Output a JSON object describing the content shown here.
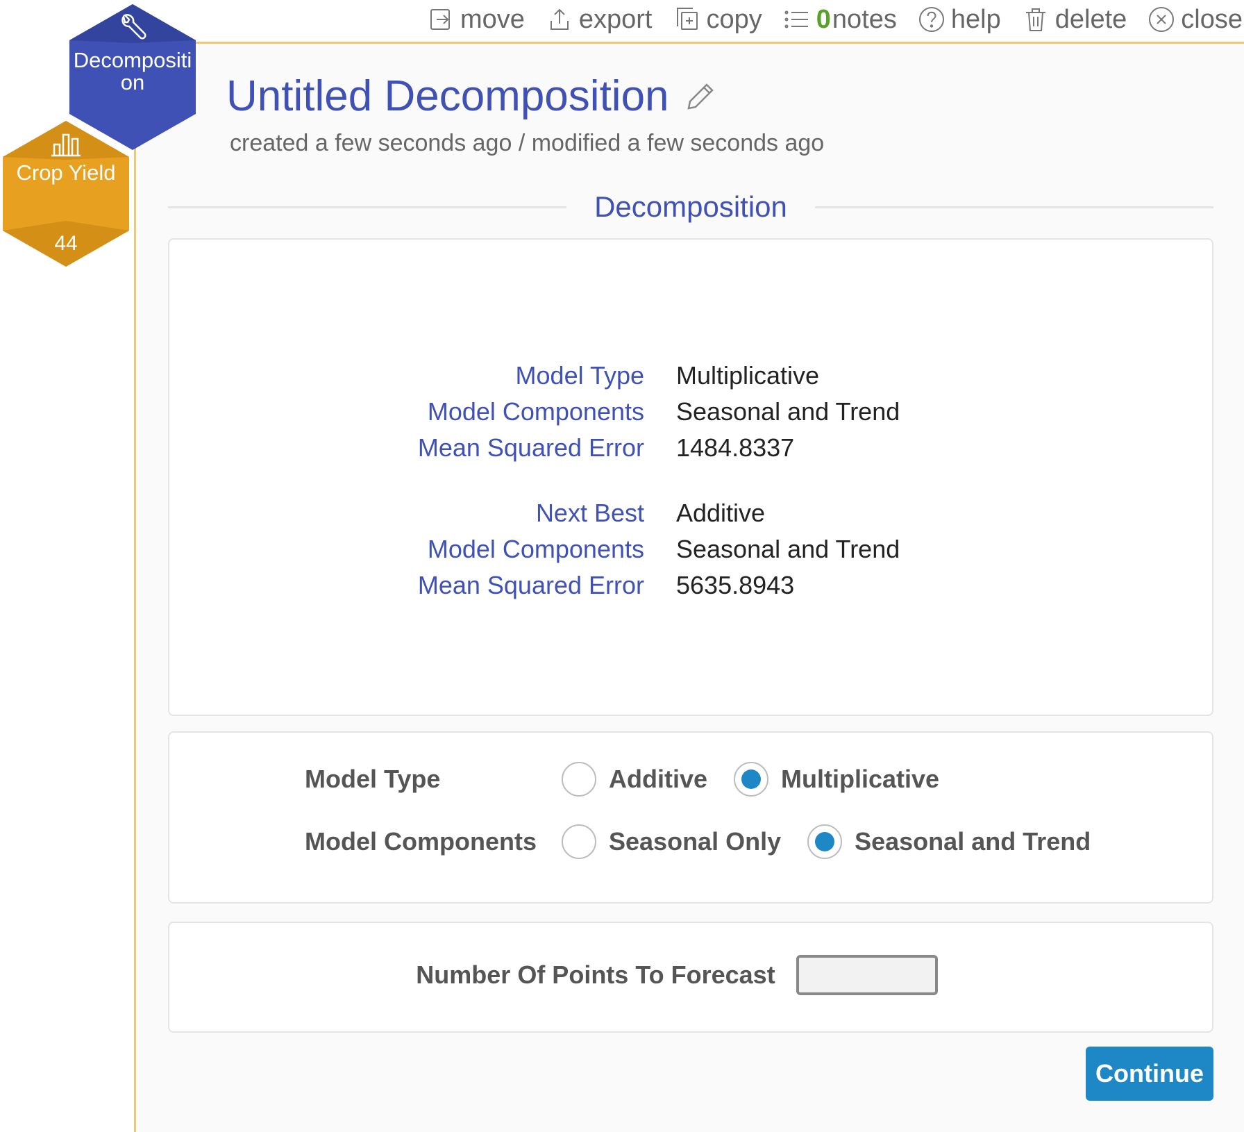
{
  "toolbar": {
    "move": "move",
    "export": "export",
    "copy": "copy",
    "notes_count": "0",
    "notes": "notes",
    "help": "help",
    "delete": "delete",
    "close": "close"
  },
  "nodes": {
    "decomposition": {
      "label_line1": "Decompositi",
      "label_line2": "on",
      "icon": "wrench-icon",
      "color": "#3f51b5"
    },
    "crop_yield": {
      "label": "Crop Yield",
      "count": "44",
      "icon": "bar-chart-icon",
      "color": "#e8a020"
    }
  },
  "header": {
    "title": "Untitled Decomposition",
    "subtitle": "created a few seconds ago / modified a few seconds ago"
  },
  "section": {
    "title": "Decomposition"
  },
  "results": {
    "best": {
      "model_type_label": "Model Type",
      "model_type_value": "Multiplicative",
      "components_label": "Model Components",
      "components_value": "Seasonal and Trend",
      "mse_label": "Mean Squared Error",
      "mse_value": "1484.8337"
    },
    "next": {
      "label": "Next Best",
      "value": "Additive",
      "components_label": "Model Components",
      "components_value": "Seasonal and Trend",
      "mse_label": "Mean Squared Error",
      "mse_value": "5635.8943"
    }
  },
  "options": {
    "model_type": {
      "label": "Model Type",
      "choices": [
        "Additive",
        "Multiplicative"
      ],
      "selected": "Multiplicative"
    },
    "model_components": {
      "label": "Model Components",
      "choices": [
        "Seasonal Only",
        "Seasonal and Trend"
      ],
      "selected": "Seasonal and Trend"
    }
  },
  "forecast": {
    "label": "Number Of Points To Forecast",
    "value": "",
    "placeholder": ""
  },
  "buttons": {
    "continue": "Continue"
  },
  "colors": {
    "accent": "#3f51b5",
    "primary_button": "#1e88c7",
    "panel_border": "#f0c677",
    "notes_count": "#5aa02c"
  }
}
